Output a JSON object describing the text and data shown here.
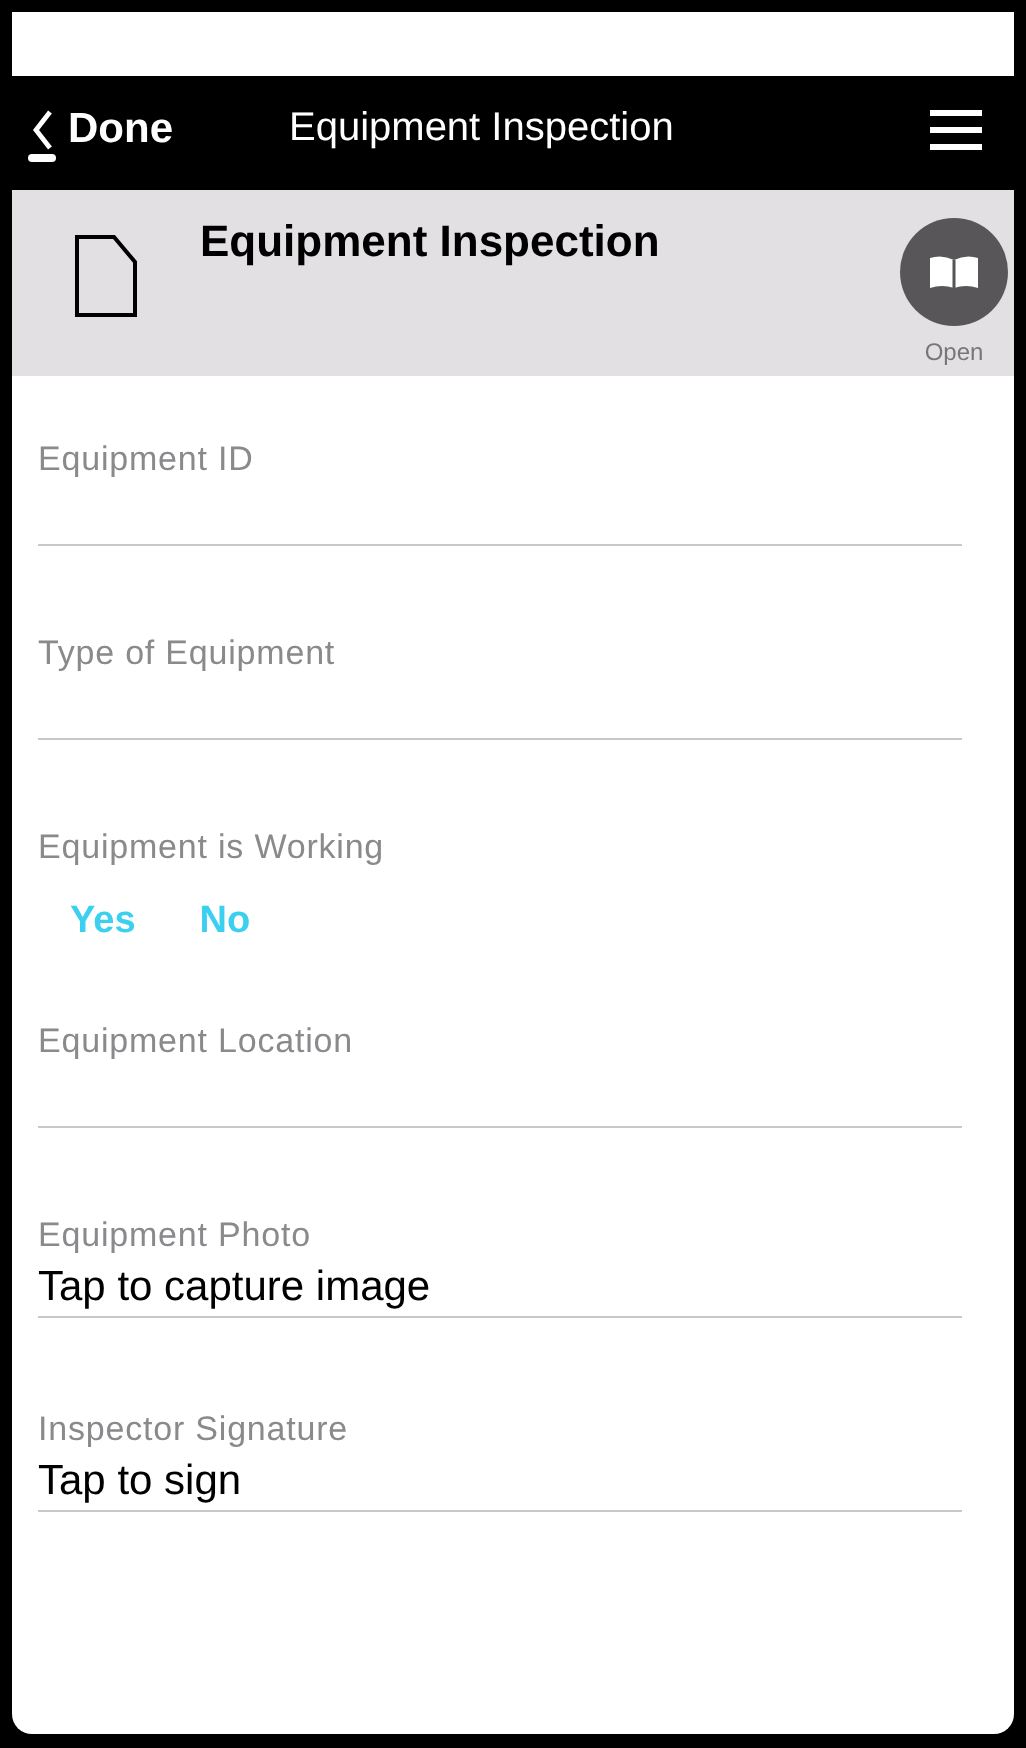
{
  "nav": {
    "back_label": "Done",
    "title": "Equipment Inspection"
  },
  "header": {
    "title": "Equipment Inspection",
    "open_label": "Open"
  },
  "fields": [
    {
      "kind": "text",
      "label": "Equipment ID"
    },
    {
      "kind": "text",
      "label": "Type of Equipment"
    },
    {
      "kind": "choice",
      "label": "Equipment is Working",
      "options": [
        {
          "label": "Yes",
          "selected": false
        },
        {
          "label": "No",
          "selected": false
        }
      ]
    },
    {
      "kind": "text",
      "label": "Equipment Location"
    },
    {
      "kind": "photo",
      "label": "Equipment Photo",
      "prompt": "Tap to capture image"
    },
    {
      "kind": "signature",
      "label": "Inspector Signature",
      "prompt": "Tap to sign"
    }
  ]
}
